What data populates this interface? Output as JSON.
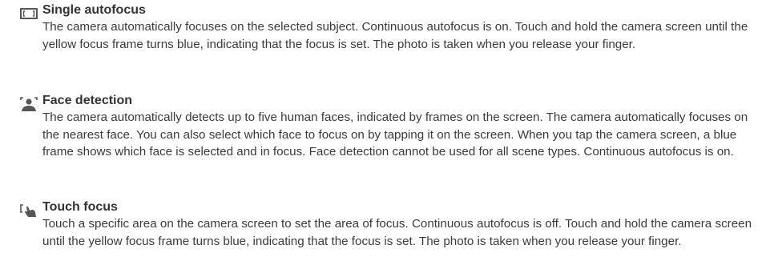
{
  "entries": [
    {
      "icon": "single-autofocus-icon",
      "title": "Single autofocus",
      "text": "The camera automatically focuses on the selected subject. Continuous autofocus is on. Touch and hold the camera screen until the yellow focus frame turns blue, indicating that the focus is set. The photo is taken when you release your finger."
    },
    {
      "icon": "face-detection-icon",
      "title": "Face detection",
      "text": "The camera automatically detects up to five human faces, indicated by frames on the screen. The camera automatically focuses on the nearest face. You can also select which face to focus on by tapping it on the screen. When you tap the camera screen, a blue frame shows which face is selected and in focus. Face detection cannot be used for all scene types. Continuous autofocus is on."
    },
    {
      "icon": "touch-focus-icon",
      "title": "Touch focus",
      "text": "Touch a specific area on the camera screen to set the area of focus. Continuous autofocus is off. Touch and hold the camera screen until the yellow focus frame turns blue, indicating that the focus is set. The photo is taken when you release your finger."
    }
  ],
  "colors": {
    "text": "#333333",
    "icon": "#555555"
  }
}
